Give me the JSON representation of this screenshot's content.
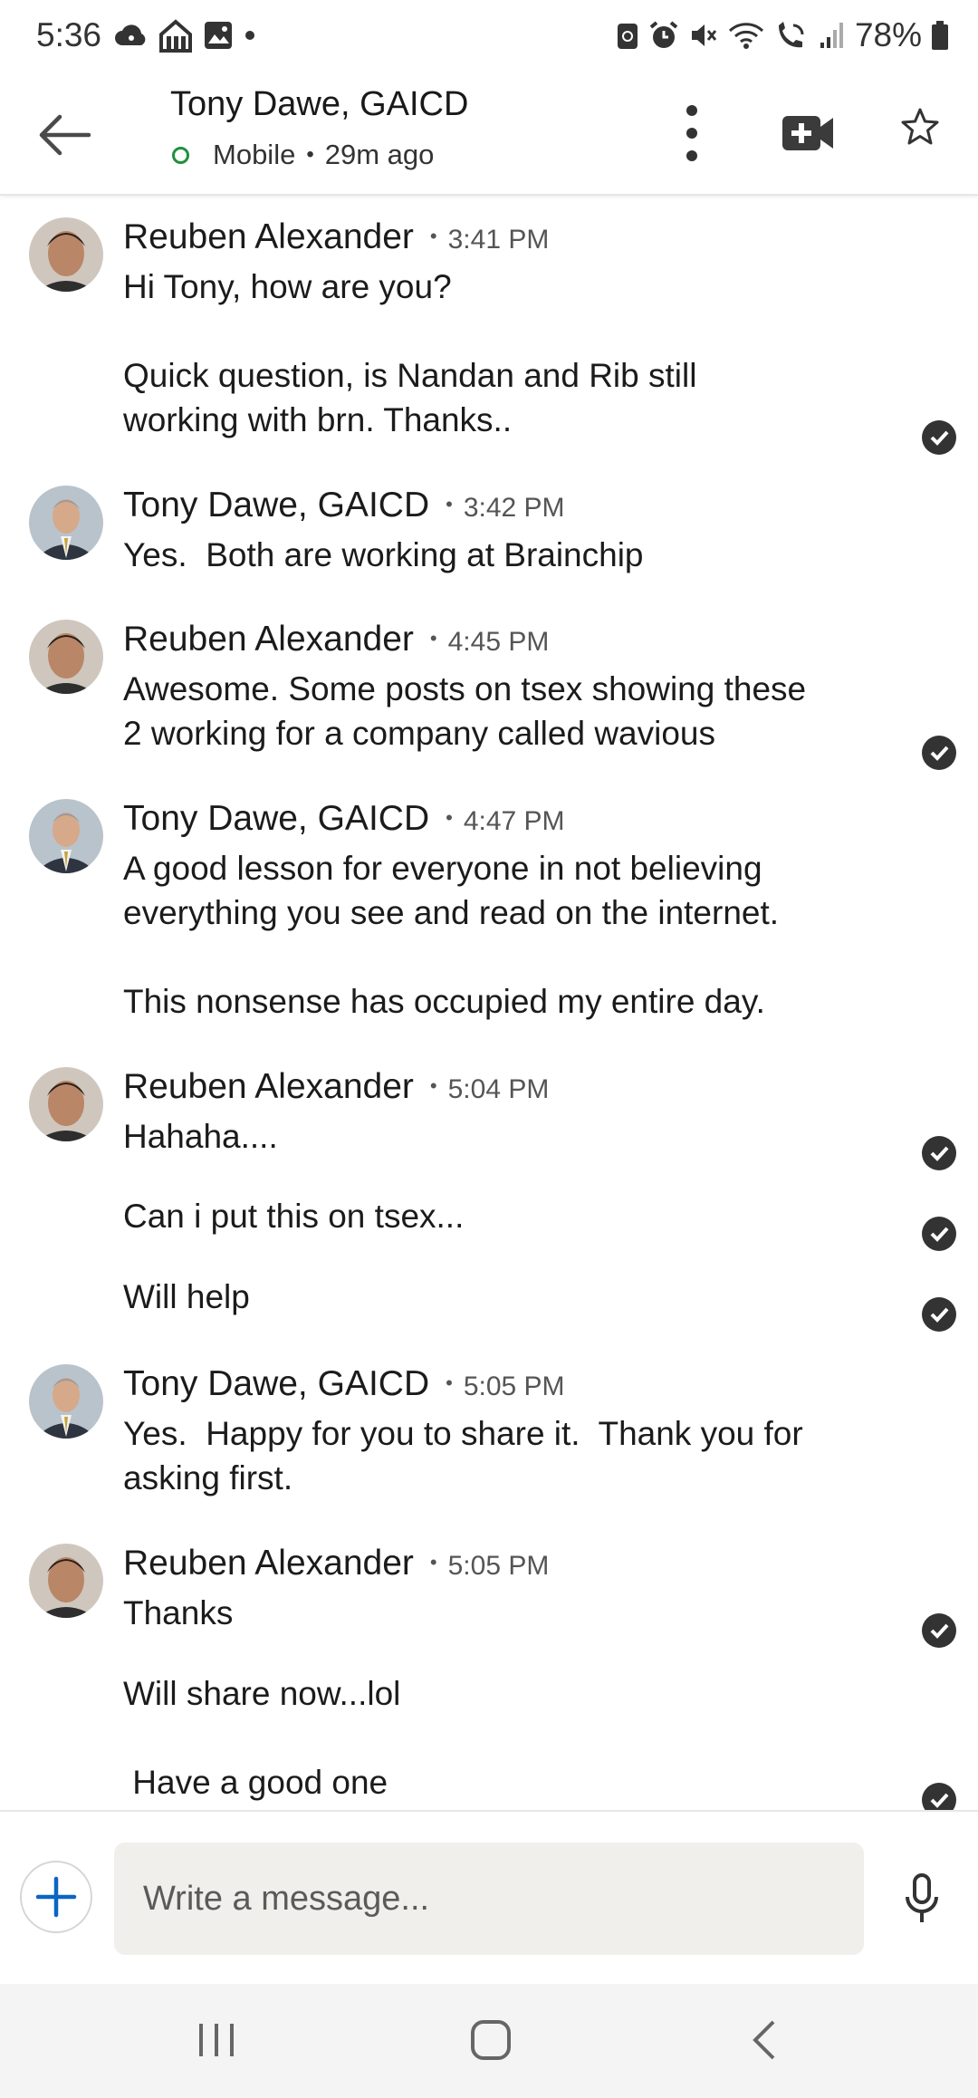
{
  "status_bar": {
    "time": "5:36",
    "battery": "78%",
    "left_icons": [
      "cloud-icon",
      "home-network-icon",
      "gallery-icon",
      "dot-icon"
    ],
    "right_icons": [
      "nfc-icon",
      "alarm-icon",
      "mute-icon",
      "wifi-icon",
      "wifi-calling-icon",
      "signal-icon",
      "battery-icon"
    ]
  },
  "header": {
    "name": "Tony Dawe, GAICD",
    "presence": "Mobile",
    "separator": "•",
    "last_seen": "29m ago",
    "presence_color": "#1f8f3e"
  },
  "messages": [
    {
      "sender": "Reuben Alexander",
      "time": "3:41 PM",
      "avatar": "reuben",
      "parts": [
        "Hi Tony, how are you?\n\nQuick question, is Nandan and Rib still\nworking with brn. Thanks.."
      ]
    },
    {
      "sender": "Tony Dawe, GAICD",
      "time": "3:42 PM",
      "avatar": "tony",
      "parts": [
        "Yes.  Both are working at Brainchip"
      ]
    },
    {
      "sender": "Reuben Alexander",
      "time": "4:45 PM",
      "avatar": "reuben",
      "parts": [
        "Awesome. Some posts on tsex showing these\n2 working for a company called wavious"
      ]
    },
    {
      "sender": "Tony Dawe, GAICD",
      "time": "4:47 PM",
      "avatar": "tony",
      "parts": [
        "A good lesson for everyone in not believing\neverything you see and read on the internet.\n\nThis nonsense has occupied my entire day."
      ]
    },
    {
      "sender": "Reuben Alexander",
      "time": "5:04 PM",
      "avatar": "reuben",
      "parts": [
        "Hahaha....",
        "Can i put this on tsex...",
        "Will help"
      ]
    },
    {
      "sender": "Tony Dawe, GAICD",
      "time": "5:05 PM",
      "avatar": "tony",
      "parts": [
        "Yes.  Happy for you to share it.  Thank you for\nasking first."
      ]
    },
    {
      "sender": "Reuben Alexander",
      "time": "5:05 PM",
      "avatar": "reuben",
      "parts": [
        "Thanks",
        "Will share now...lol",
        " Have a good one"
      ]
    }
  ],
  "composer": {
    "placeholder": "Write a message..."
  },
  "colors": {
    "accent": "#0a66c2",
    "read_check": "#333333",
    "input_bg": "#f1efeb"
  }
}
